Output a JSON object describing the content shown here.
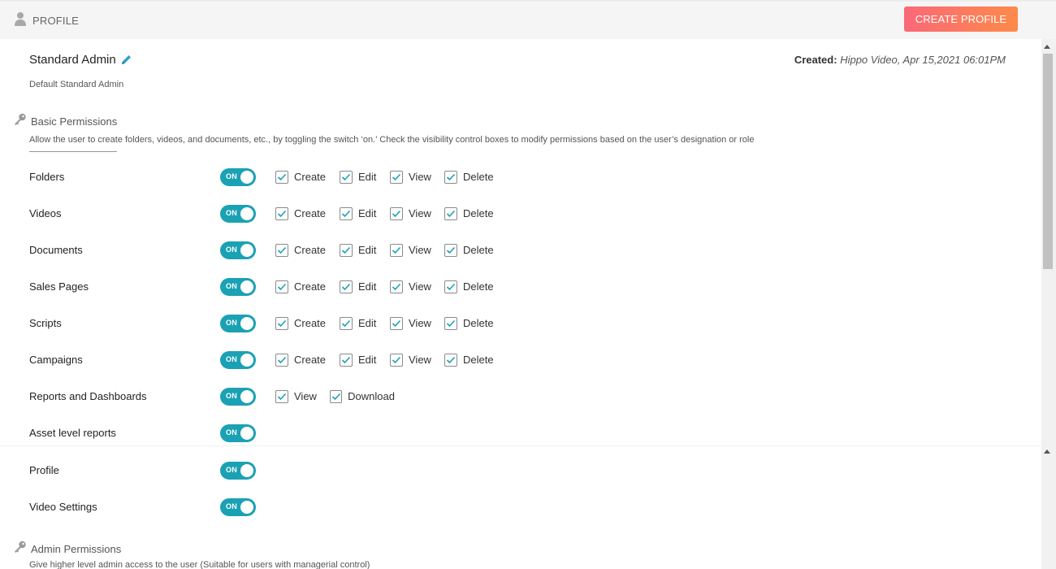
{
  "header": {
    "title": "PROFILE",
    "create_button": "CREATE PROFILE"
  },
  "profile": {
    "name": "Standard Admin",
    "description": "Default Standard Admin",
    "created_label": "Created:",
    "created_value": "Hippo Video, Apr 15,2021 06:01PM"
  },
  "basic": {
    "title": "Basic Permissions",
    "description": "Allow the user to create folders, videos, and documents, etc., by toggling the switch ‘on.’ Check the visibility control boxes to modify permissions based on the user’s designation or role"
  },
  "admin": {
    "title": "Admin Permissions",
    "description": "Give higher level admin access to the user (Suitable for users with managerial control)"
  },
  "toggle_on_text": "ON",
  "permissions": [
    {
      "name": "Folders",
      "on": true,
      "options": [
        {
          "label": "Create",
          "checked": true
        },
        {
          "label": "Edit",
          "checked": true
        },
        {
          "label": "View",
          "checked": true
        },
        {
          "label": "Delete",
          "checked": true
        }
      ]
    },
    {
      "name": "Videos",
      "on": true,
      "options": [
        {
          "label": "Create",
          "checked": true
        },
        {
          "label": "Edit",
          "checked": true
        },
        {
          "label": "View",
          "checked": true
        },
        {
          "label": "Delete",
          "checked": true
        }
      ]
    },
    {
      "name": "Documents",
      "on": true,
      "options": [
        {
          "label": "Create",
          "checked": true
        },
        {
          "label": "Edit",
          "checked": true
        },
        {
          "label": "View",
          "checked": true
        },
        {
          "label": "Delete",
          "checked": true
        }
      ]
    },
    {
      "name": "Sales Pages",
      "on": true,
      "options": [
        {
          "label": "Create",
          "checked": true
        },
        {
          "label": "Edit",
          "checked": true
        },
        {
          "label": "View",
          "checked": true
        },
        {
          "label": "Delete",
          "checked": true
        }
      ]
    },
    {
      "name": "Scripts",
      "on": true,
      "options": [
        {
          "label": "Create",
          "checked": true
        },
        {
          "label": "Edit",
          "checked": true
        },
        {
          "label": "View",
          "checked": true
        },
        {
          "label": "Delete",
          "checked": true
        }
      ]
    },
    {
      "name": "Campaigns",
      "on": true,
      "options": [
        {
          "label": "Create",
          "checked": true
        },
        {
          "label": "Edit",
          "checked": true
        },
        {
          "label": "View",
          "checked": true
        },
        {
          "label": "Delete",
          "checked": true
        }
      ]
    },
    {
      "name": "Reports and Dashboards",
      "on": true,
      "options": [
        {
          "label": "View",
          "checked": true
        },
        {
          "label": "Download",
          "checked": true
        }
      ]
    },
    {
      "name": "Asset level reports",
      "on": true,
      "options": []
    },
    {
      "name": "Profile",
      "on": true,
      "options": []
    },
    {
      "name": "Video Settings",
      "on": true,
      "options": []
    }
  ],
  "colors": {
    "toggle_on": "#1ba1b4",
    "check": "#1ba1b4",
    "button_start": "#fa6877",
    "button_end": "#fd8a4a"
  }
}
